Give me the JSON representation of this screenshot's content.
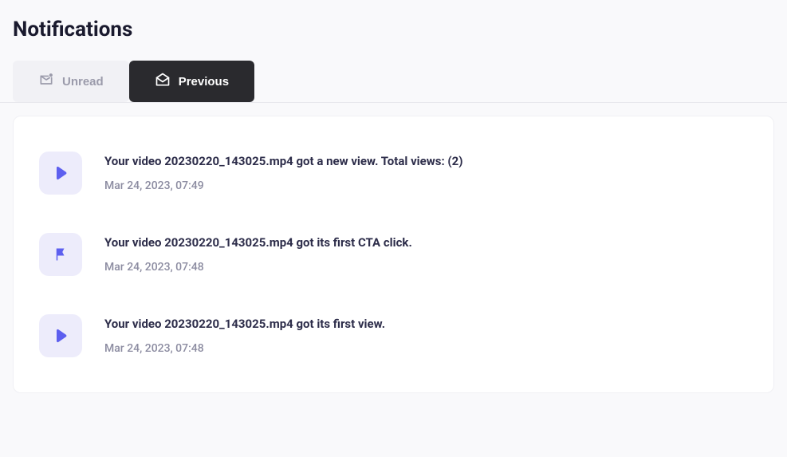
{
  "page": {
    "title": "Notifications"
  },
  "tabs": {
    "unread": {
      "label": "Unread"
    },
    "previous": {
      "label": "Previous"
    }
  },
  "notifications": [
    {
      "icon": "play",
      "message": "Your video 20230220_143025.mp4 got a new view. Total views: (2)",
      "time": "Mar 24, 2023, 07:49"
    },
    {
      "icon": "flag",
      "message": "Your video 20230220_143025.mp4 got its first CTA click.",
      "time": "Mar 24, 2023, 07:48"
    },
    {
      "icon": "play",
      "message": "Your video 20230220_143025.mp4 got its first view.",
      "time": "Mar 24, 2023, 07:48"
    }
  ]
}
